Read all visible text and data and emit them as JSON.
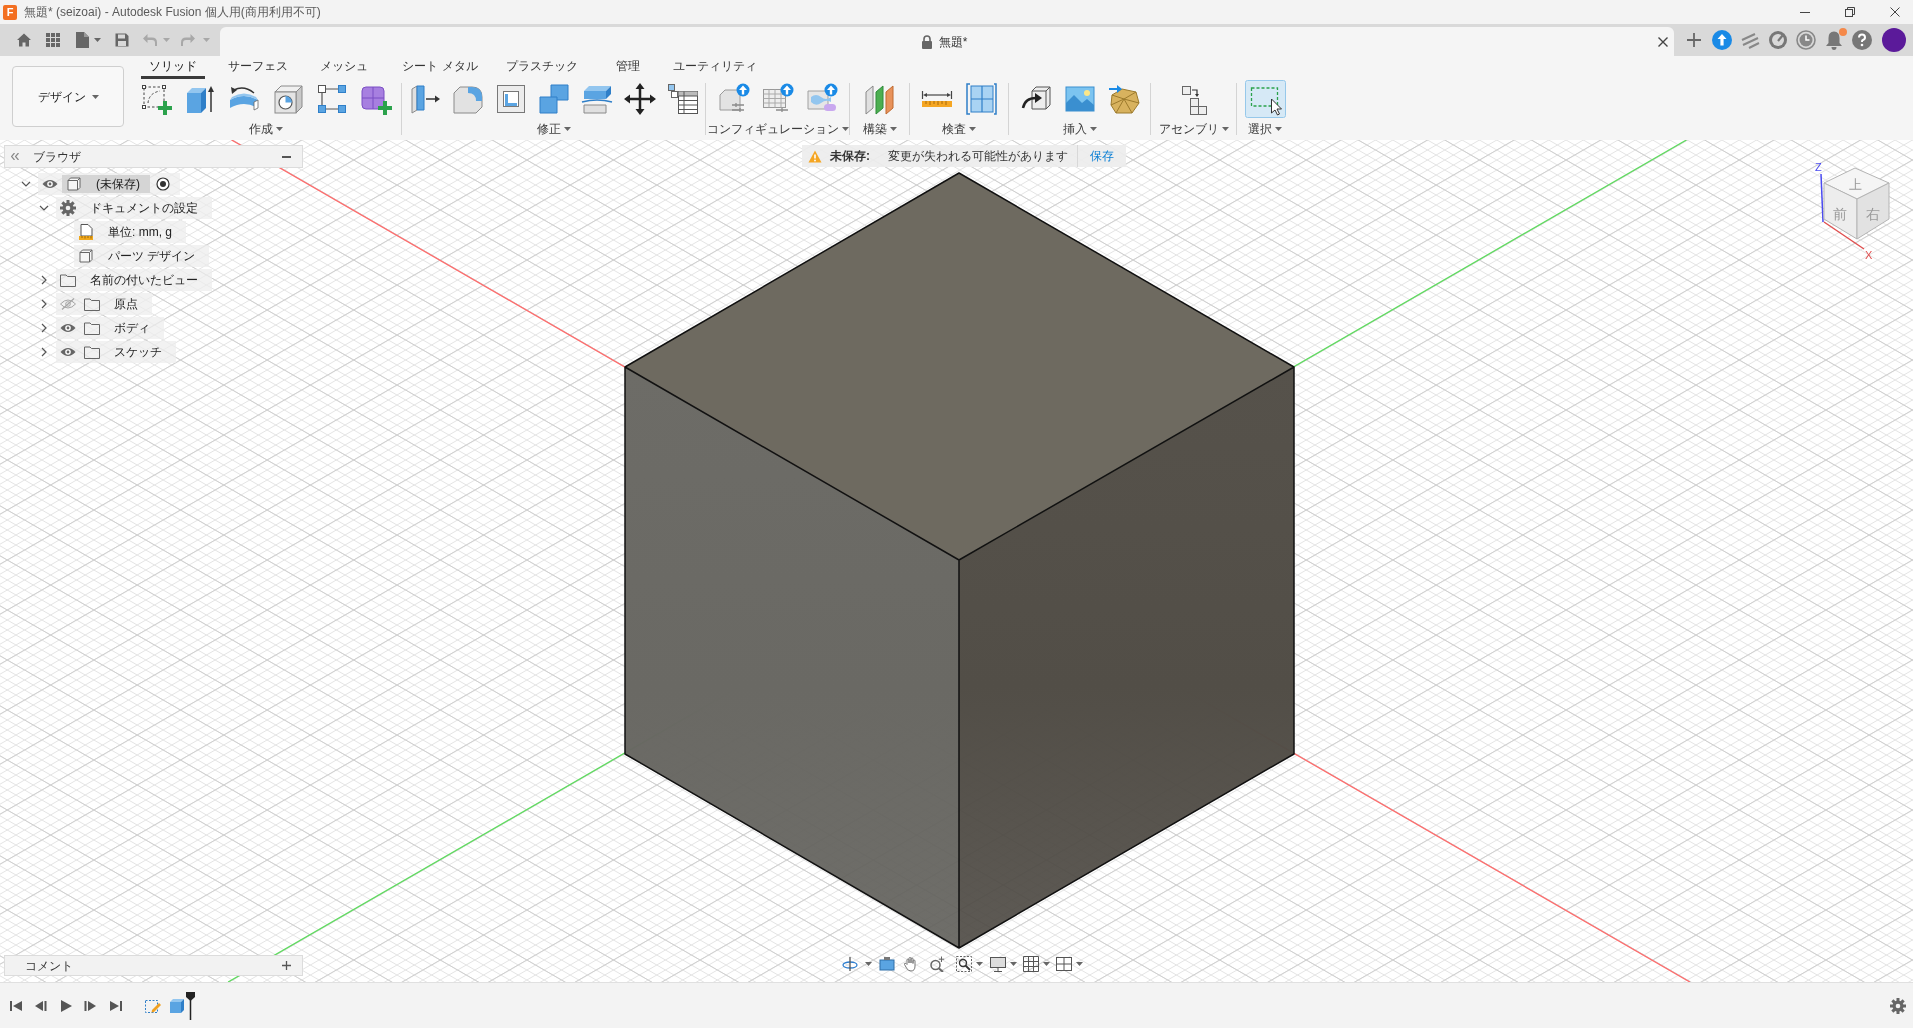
{
  "window": {
    "app_icon_letter": "F",
    "title": "無題* (seizoai) - Autodesk Fusion 個人用(商用利用不可)"
  },
  "quick_access": {
    "undo": {
      "disabled": true
    },
    "redo": {
      "disabled": true
    }
  },
  "document_tab": {
    "title": "無題*",
    "locked": true
  },
  "notifications": {
    "unread": true
  },
  "toolbar": {
    "workspace": "デザイン",
    "tabs": [
      {
        "label": "ソリッド",
        "selected": true
      },
      {
        "label": "サーフェス",
        "selected": false
      },
      {
        "label": "メッシュ",
        "selected": false
      },
      {
        "label": "シート メタル",
        "selected": false
      },
      {
        "label": "プラスチック",
        "selected": false
      },
      {
        "label": "管理",
        "selected": false
      },
      {
        "label": "ユーティリティ",
        "selected": false
      }
    ],
    "groups": [
      {
        "label": "作成",
        "active": false
      },
      {
        "label": "修正",
        "active": false
      },
      {
        "label": "コンフィギュレーション",
        "active": false
      },
      {
        "label": "構築",
        "active": false
      },
      {
        "label": "検査",
        "active": false
      },
      {
        "label": "挿入",
        "active": false
      },
      {
        "label": "アセンブリ",
        "active": false
      },
      {
        "label": "選択",
        "active": true
      }
    ]
  },
  "browser": {
    "title": "ブラウザ",
    "tree": [
      {
        "label": "(未保存)",
        "kind": "component",
        "expanded": true,
        "visible": true,
        "active": true,
        "children": [
          {
            "label": "ドキュメントの設定",
            "kind": "settings",
            "expanded": true,
            "children": [
              {
                "label": "単位: mm, g",
                "kind": "units"
              },
              {
                "label": "パーツ デザイン",
                "kind": "part"
              }
            ]
          },
          {
            "label": "名前の付いたビュー",
            "kind": "folder",
            "expanded": false
          },
          {
            "label": "原点",
            "kind": "folder",
            "expanded": false,
            "visible": false
          },
          {
            "label": "ボディ",
            "kind": "folder",
            "expanded": false,
            "visible": true
          },
          {
            "label": "スケッチ",
            "kind": "folder",
            "expanded": false,
            "visible": true
          }
        ]
      }
    ]
  },
  "unsaved_banner": {
    "label": "未保存:",
    "message": "変更が失われる可能性があります",
    "action": "保存"
  },
  "view_cube": {
    "top": "上",
    "front": "前",
    "right": "右",
    "axis_z": "Z",
    "axis_x": "X"
  },
  "comments": {
    "title": "コメント"
  },
  "timeline": {
    "features": [
      {
        "kind": "sketch"
      },
      {
        "kind": "extrude"
      }
    ]
  }
}
